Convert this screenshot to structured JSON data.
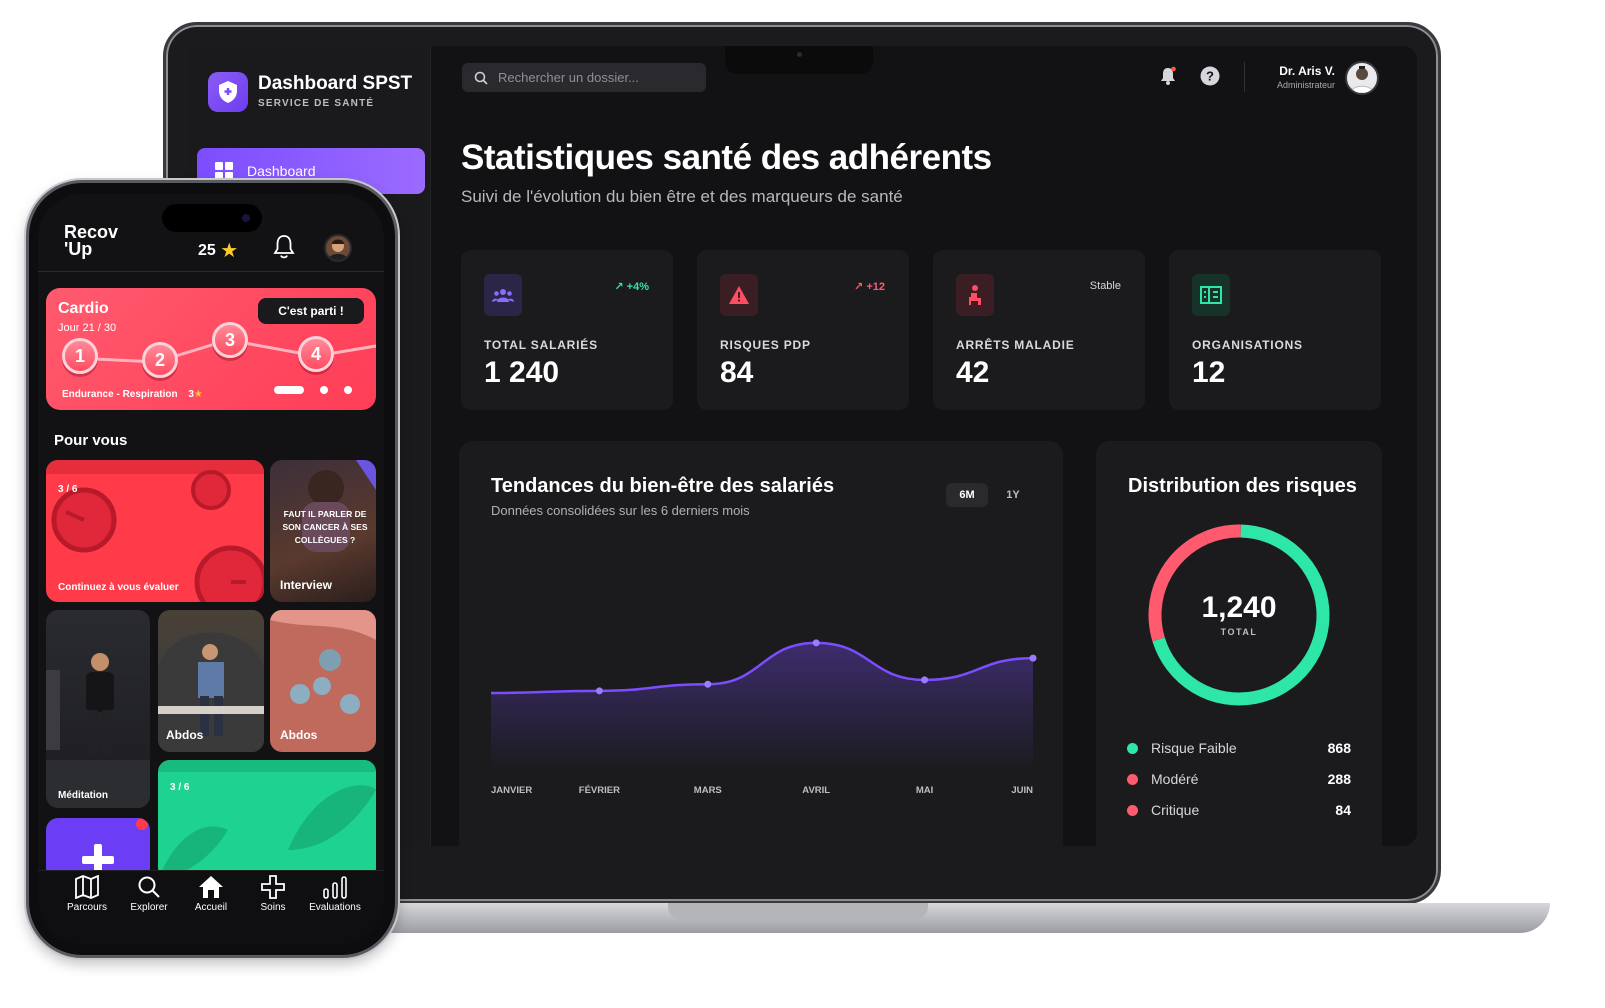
{
  "desktop": {
    "brand": {
      "title": "Dashboard SPST",
      "subtitle": "SERVICE DE SANTÉ"
    },
    "nav": {
      "active_label": "Dashboard"
    },
    "search": {
      "placeholder": "Rechercher un dossier..."
    },
    "user": {
      "name": "Dr. Aris V.",
      "role": "Administrateur"
    },
    "page": {
      "title": "Statistiques santé des adhérents",
      "subtitle": "Suivi de l'évolution du bien être et des marqueurs de santé"
    },
    "stats": [
      {
        "label": "TOTAL SALARIÉS",
        "value": "1 240",
        "trend": "+4%",
        "icon": "users-icon",
        "color": "#7c4dff"
      },
      {
        "label": "RISQUES PDP",
        "value": "84",
        "trend": "+12",
        "icon": "warning-icon",
        "color": "#ff4d62"
      },
      {
        "label": "ARRÊTS MALADIE",
        "value": "42",
        "trend": "Stable",
        "icon": "person-icon",
        "color": "#ff4d62"
      },
      {
        "label": "ORGANISATIONS",
        "value": "12",
        "trend": "",
        "icon": "building-icon",
        "color": "#2ee6a6"
      }
    ],
    "trend_panel": {
      "title": "Tendances du bien-être des salariés",
      "subtitle": "Données consolidées sur les 6 derniers mois",
      "range_options": [
        "6M",
        "1Y"
      ],
      "selected_range": "6M"
    },
    "risk_panel": {
      "title": "Distribution des risques",
      "total_value": "1,240",
      "total_label": "TOTAL",
      "legend": [
        {
          "name": "Risque Faible",
          "value": "868",
          "color": "#2ee6a6"
        },
        {
          "name": "Modéré",
          "value": "288",
          "color": "#ff5a6e"
        },
        {
          "name": "Critique",
          "value": "84",
          "color": "#ff5a6e"
        }
      ]
    }
  },
  "chart_data": [
    {
      "type": "line",
      "categories": [
        "JANVIER",
        "FÉVRIER",
        "MARS",
        "AVRIL",
        "MAI",
        "JUIN"
      ],
      "series": [
        {
          "values": [
            62,
            63,
            66,
            85,
            68,
            78
          ]
        }
      ],
      "ylim": [
        40,
        95
      ],
      "grid": false,
      "color": "#7c4dff"
    },
    {
      "type": "pie",
      "categories": [
        "Risque Faible",
        "Modéré",
        "Critique"
      ],
      "values": [
        868,
        288,
        84
      ],
      "colors": [
        "#2ee6a6",
        "#ff5a6e",
        "#ff5a6e"
      ]
    }
  ],
  "mobile": {
    "logo": {
      "line1": "Recov",
      "line2": "'Up"
    },
    "points": "25",
    "cardio": {
      "title": "Cardio",
      "day": "Jour 21 / 30",
      "cta": "C'est parti !",
      "steps": [
        "1",
        "2",
        "3",
        "4"
      ],
      "footer": "Endurance - Respiration",
      "stars": "3"
    },
    "section_title": "Pour vous",
    "tiles": {
      "evaluate": {
        "count": "3 / 6",
        "label": "Continuez à vous évaluer"
      },
      "interview": {
        "quote": "FAUT IL PARLER DE SON CANCER À SES COLLÈGUES ?",
        "label": "Interview"
      },
      "meditation": {
        "label": "Méditation"
      },
      "abdos1": {
        "label": "Abdos"
      },
      "abdos2": {
        "label": "Abdos"
      },
      "green": {
        "count": "3 / 6"
      }
    },
    "tabs": [
      "Parcours",
      "Explorer",
      "Accueil",
      "Soins",
      "Evaluations"
    ]
  }
}
